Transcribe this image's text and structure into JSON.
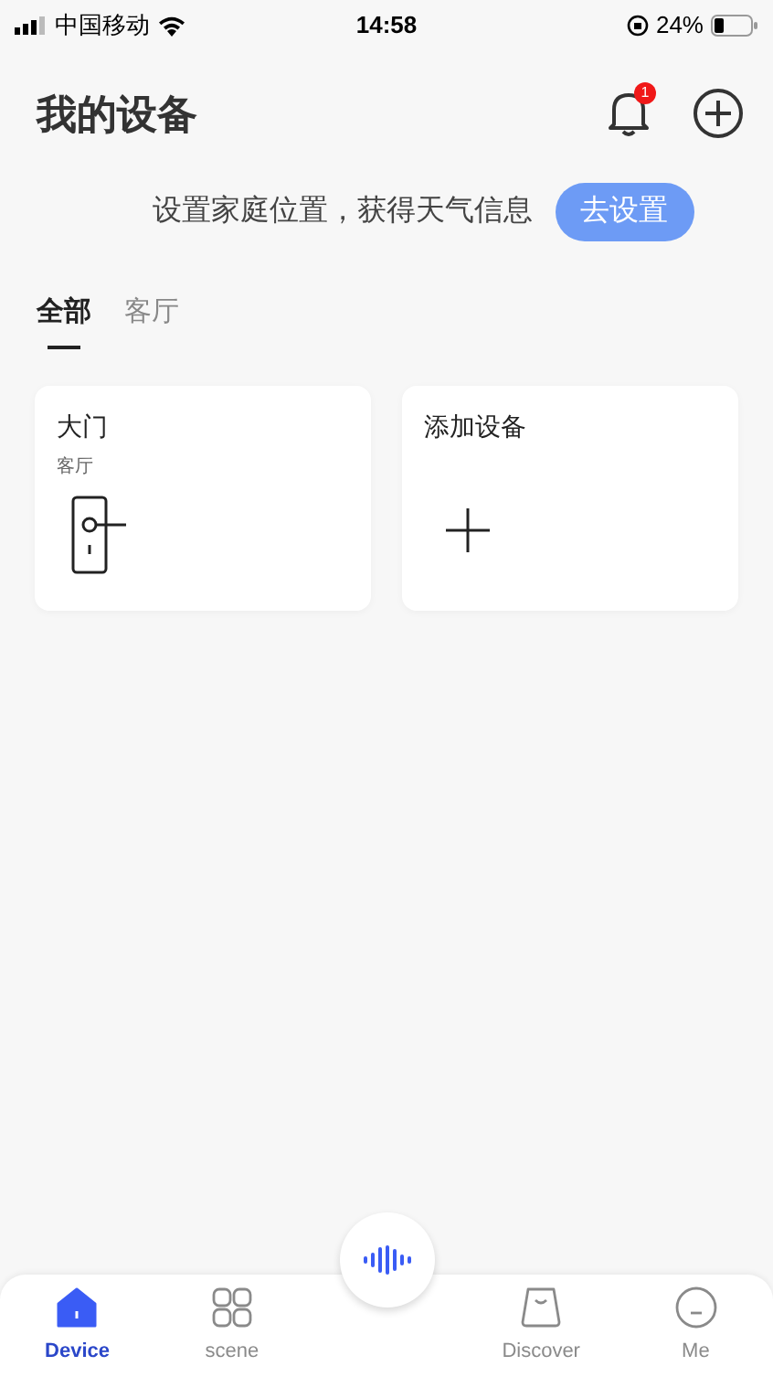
{
  "status_bar": {
    "carrier": "中国移动",
    "time": "14:58",
    "battery": "24%"
  },
  "header": {
    "title": "我的设备",
    "notification_badge": "1"
  },
  "banner": {
    "text": "设置家庭位置，获得天气信息",
    "button": "去设置"
  },
  "tabs": [
    {
      "label": "全部",
      "selected": true
    },
    {
      "label": "客厅",
      "selected": false
    }
  ],
  "cards": [
    {
      "kind": "device",
      "title": "大门",
      "room": "客厅"
    },
    {
      "kind": "add",
      "title": "添加设备"
    }
  ],
  "bottom_nav": [
    {
      "label": "Device",
      "kind": "home",
      "selected": true
    },
    {
      "label": "scene",
      "kind": "scene",
      "selected": false
    },
    {
      "label": "Discover",
      "kind": "discover",
      "selected": false
    },
    {
      "label": "Me",
      "kind": "profile",
      "selected": false
    }
  ]
}
